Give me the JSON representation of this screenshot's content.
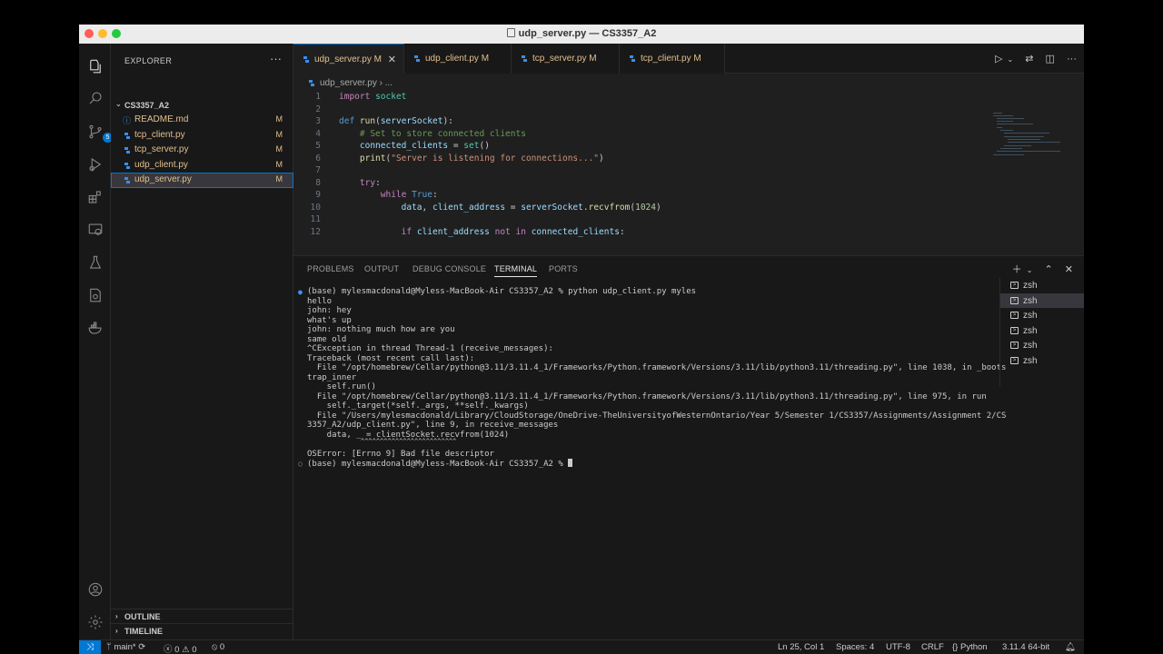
{
  "window": {
    "title": "udp_server.py — CS3357_A2"
  },
  "activity_bar": {
    "source_control_badge": "5"
  },
  "sidebar": {
    "header": "EXPLORER",
    "more": "···",
    "folder": "CS3357_A2",
    "files": [
      {
        "name": "README.md",
        "status": "M"
      },
      {
        "name": "tcp_client.py",
        "status": "M"
      },
      {
        "name": "tcp_server.py",
        "status": "M"
      },
      {
        "name": "udp_client.py",
        "status": "M"
      },
      {
        "name": "udp_server.py",
        "status": "M"
      }
    ],
    "outline": "OUTLINE",
    "timeline": "TIMELINE"
  },
  "tabs": [
    {
      "label": "udp_server.py",
      "status": "M"
    },
    {
      "label": "udp_client.py",
      "status": "M"
    },
    {
      "label": "tcp_server.py",
      "status": "M"
    },
    {
      "label": "tcp_client.py",
      "status": "M"
    }
  ],
  "breadcrumb": {
    "file": "udp_server.py",
    "more": "..."
  },
  "code": {
    "line_numbers": [
      "1",
      "2",
      "3",
      "4",
      "5",
      "6",
      "7",
      "8",
      "9",
      "10",
      "11",
      "12"
    ]
  },
  "panel": {
    "tabs": [
      "PROBLEMS",
      "OUTPUT",
      "DEBUG CONSOLE",
      "TERMINAL",
      "PORTS"
    ],
    "terminal_lines": [
      "(base) mylesmacdonald@Myless-MacBook-Air CS3357_A2 % python udp_client.py myles",
      "hello",
      "john: hey",
      "what's up",
      "john: nothing much how are you",
      "same old",
      "^CException in thread Thread-1 (receive_messages):",
      "Traceback (most recent call last):",
      "  File \"/opt/homebrew/Cellar/python@3.11/3.11.4_1/Frameworks/Python.framework/Versions/3.11/lib/python3.11/threading.py\", line 1038, in _boots",
      "trap_inner",
      "    self.run()",
      "  File \"/opt/homebrew/Cellar/python@3.11/3.11.4_1/Frameworks/Python.framework/Versions/3.11/lib/python3.11/threading.py\", line 975, in run",
      "    self._target(*self._args, **self._kwargs)",
      "  File \"/Users/mylesmacdonald/Library/CloudStorage/OneDrive-TheUniversityofWesternOntario/Year 5/Semester 1/CS3357/Assignments/Assignment 2/CS",
      "3357_A2/udp_client.py\", line 9, in receive_messages",
      "    data, _ = clientSocket.recvfrom(1024)",
      "              ^^^^^^^^^^^^^^^^^^^^^^^^^",
      "OSError: [Errno 9] Bad file descriptor",
      "(base) mylesmacdonald@Myless-MacBook-Air CS3357_A2 % "
    ],
    "terminals": [
      "zsh",
      "zsh",
      "zsh",
      "zsh",
      "zsh",
      "zsh"
    ]
  },
  "status_bar": {
    "branch": "main*",
    "errors": "0",
    "warnings": "0",
    "ports": "0",
    "cursor": "Ln 25, Col 1",
    "spaces": "Spaces: 4",
    "encoding": "UTF-8",
    "eol": "CRLF",
    "language": "Python",
    "interpreter": "3.11.4 64-bit"
  },
  "colors": {
    "accent": "#0078d4",
    "modified": "#e2c08d",
    "editor_bg": "#1f1f1f",
    "sidebar_bg": "#181818",
    "python_icon": "#3b8eea"
  },
  "icons": {
    "activity": [
      "explorer-icon",
      "search-icon",
      "source-control-icon",
      "run-debug-icon",
      "extensions-icon",
      "remote-explorer-icon",
      "testing-icon",
      "security-icon",
      "docker-icon",
      "account-icon",
      "settings-gear-icon"
    ]
  }
}
